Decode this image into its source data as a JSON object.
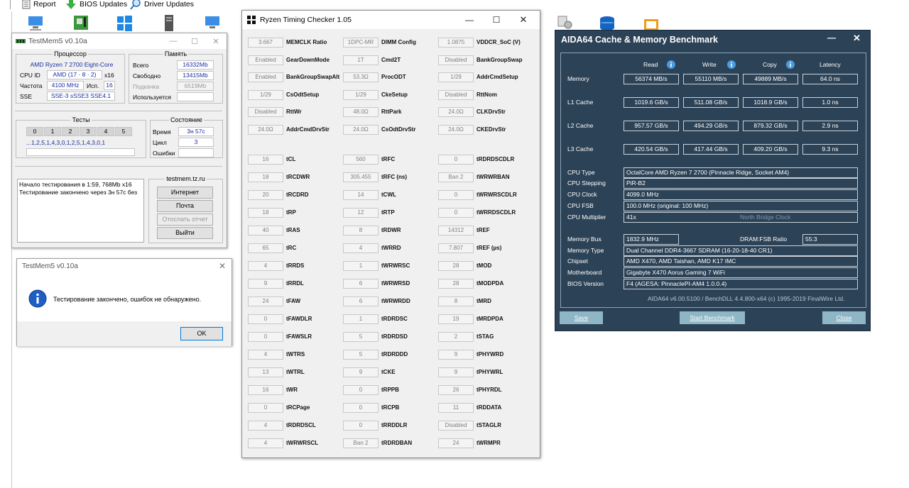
{
  "toolbar": {
    "report": "Report",
    "bios_updates": "BIOS Updates",
    "driver_updates": "Driver Updates"
  },
  "testmem_main": {
    "title": "TestMem5 v0.10a",
    "processor_legend": "Процессор",
    "cpu_name": "AMD Ryzen 7 2700 Eight-Core",
    "cpuid_label": "CPU ID",
    "cpuid_value": "AMD  (17 · 8 · 2)",
    "cpuid_threads": "x16",
    "freq_label": "Частота",
    "freq_value": "4100 MHz",
    "used_label": "Исп.",
    "used_value": "16",
    "sse_label": "SSE",
    "sse_value": "SSE-3 sSSE3 SSE4.1",
    "memory_legend": "Память",
    "total_label": "Всего",
    "total_value": "16332Mb",
    "free_label": "Свободно",
    "free_value": "13415Mb",
    "swap_label": "Подкачка",
    "swap_value": "6519Mb",
    "used2_label": "Используется",
    "used2_value": "",
    "tests_legend": "Тесты",
    "test_tabs": [
      "0",
      "1",
      "2",
      "3",
      "4",
      "5"
    ],
    "test_sequence": "...1,2,5,1,4,3,0,1,2,5,1,4,3,0,1",
    "state_legend": "Состояние",
    "time_label": "Время",
    "time_value": "3н 57с",
    "cycle_label": "Цикл",
    "cycle_value": "3",
    "errors_label": "Ошибки",
    "errors_value": "",
    "log_lines": [
      "Начало тестирования в 1:59, 768Mb x16",
      "Тестирование закончено через 3н 57с без"
    ],
    "site_legend": "testmem.tz.ru",
    "btn_internet": "Интернет",
    "btn_mail": "Почта",
    "btn_report": "Отослать отчет",
    "btn_exit": "Выйти"
  },
  "testmem_dialog": {
    "title": "TestMem5 v0.10a",
    "message": "Тестирование закончено, ошибок не обнаружено.",
    "ok": "OK"
  },
  "rtc": {
    "title": "Ryzen Timing Checker 1.05",
    "rows": [
      [
        [
          "3.667",
          "MEMCLK Ratio"
        ],
        [
          "1DPC-MR",
          "DIMM Config"
        ],
        [
          "1.0875",
          "VDDCR_SoC (V)"
        ]
      ],
      [
        [
          "Enabled",
          "GearDownMode"
        ],
        [
          "1T",
          "Cmd2T"
        ],
        [
          "Disabled",
          "BankGroupSwap"
        ]
      ],
      [
        [
          "Enabled",
          "BankGroupSwapAlt"
        ],
        [
          "53.3Ω",
          "ProcODT"
        ],
        [
          "1/29",
          "AddrCmdSetup"
        ]
      ],
      [
        [
          "1/29",
          "CsOdtSetup"
        ],
        [
          "1/29",
          "CkeSetup"
        ],
        [
          "Disabled",
          "RttNom"
        ]
      ],
      [
        [
          "Disabled",
          "RttWr"
        ],
        [
          "48.0Ω",
          "RttPark"
        ],
        [
          "24.0Ω",
          "CLKDrvStr"
        ]
      ],
      [
        [
          "24.0Ω",
          "AddrCmdDrvStr"
        ],
        [
          "24.0Ω",
          "CsOdtDrvStr"
        ],
        [
          "24.0Ω",
          "CKEDrvStr"
        ]
      ],
      [
        [
          "16",
          "tCL"
        ],
        [
          "560",
          "tRFC"
        ],
        [
          "0",
          "tRDRDSCDLR"
        ]
      ],
      [
        [
          "18",
          "tRCDWR"
        ],
        [
          "305.455",
          "tRFC (ns)"
        ],
        [
          "Ban 2",
          "tWRWRBAN"
        ]
      ],
      [
        [
          "20",
          "tRCDRD"
        ],
        [
          "14",
          "tCWL"
        ],
        [
          "0",
          "tWRWRSCDLR"
        ]
      ],
      [
        [
          "18",
          "tRP"
        ],
        [
          "12",
          "tRTP"
        ],
        [
          "0",
          "tWRRDSCDLR"
        ]
      ],
      [
        [
          "40",
          "tRAS"
        ],
        [
          "8",
          "tRDWR"
        ],
        [
          "14312",
          "tREF"
        ]
      ],
      [
        [
          "65",
          "tRC"
        ],
        [
          "4",
          "tWRRD"
        ],
        [
          "7.807",
          "tREF (µs)"
        ]
      ],
      [
        [
          "4",
          "tRRDS"
        ],
        [
          "1",
          "tWRWRSC"
        ],
        [
          "28",
          "tMOD"
        ]
      ],
      [
        [
          "9",
          "tRRDL"
        ],
        [
          "6",
          "tWRWRSD"
        ],
        [
          "28",
          "tMODPDA"
        ]
      ],
      [
        [
          "24",
          "tFAW"
        ],
        [
          "6",
          "tWRWRDD"
        ],
        [
          "8",
          "tMRD"
        ]
      ],
      [
        [
          "0",
          "tFAWDLR"
        ],
        [
          "1",
          "tRDRDSC"
        ],
        [
          "19",
          "tMRDPDA"
        ]
      ],
      [
        [
          "0",
          "tFAWSLR"
        ],
        [
          "5",
          "tRDRDSD"
        ],
        [
          "2",
          "tSTAG"
        ]
      ],
      [
        [
          "4",
          "tWTRS"
        ],
        [
          "5",
          "tRDRDDD"
        ],
        [
          "9",
          "tPHYWRD"
        ]
      ],
      [
        [
          "13",
          "tWTRL"
        ],
        [
          "9",
          "tCKE"
        ],
        [
          "9",
          "tPHYWRL"
        ]
      ],
      [
        [
          "16",
          "tWR"
        ],
        [
          "0",
          "tRPPB"
        ],
        [
          "26",
          "tPHYRDL"
        ]
      ],
      [
        [
          "0",
          "tRCPage"
        ],
        [
          "0",
          "tRCPB"
        ],
        [
          "11",
          "tRDDATA"
        ]
      ],
      [
        [
          "4",
          "tRDRDSCL"
        ],
        [
          "0",
          "tRRDDLR"
        ],
        [
          "Disabled",
          "tSTAGLR"
        ]
      ],
      [
        [
          "4",
          "tWRWRSCL"
        ],
        [
          "Ban 2",
          "tRDRDBAN"
        ],
        [
          "24",
          "tWRMPR"
        ]
      ]
    ]
  },
  "aida": {
    "title": "AIDA64 Cache & Memory Benchmark",
    "col_read": "Read",
    "col_write": "Write",
    "col_copy": "Copy",
    "col_latency": "Latency",
    "bench": [
      {
        "label": "Memory",
        "read": "56374 MB/s",
        "write": "55110 MB/s",
        "copy": "49889 MB/s",
        "latency": "64.0 ns"
      },
      {
        "label": "L1 Cache",
        "read": "1019.6 GB/s",
        "write": "511.08 GB/s",
        "copy": "1018.9 GB/s",
        "latency": "1.0 ns"
      },
      {
        "label": "L2 Cache",
        "read": "957.57 GB/s",
        "write": "494.29 GB/s",
        "copy": "879.32 GB/s",
        "latency": "2.9 ns"
      },
      {
        "label": "L3 Cache",
        "read": "420.54 GB/s",
        "write": "417.44 GB/s",
        "copy": "409.20 GB/s",
        "latency": "9.3 ns"
      }
    ],
    "cpu_type_label": "CPU Type",
    "cpu_type": "OctalCore AMD Ryzen 7 2700  (Pinnacle Ridge, Socket AM4)",
    "cpu_stepping_label": "CPU Stepping",
    "cpu_stepping": "PiR-B2",
    "cpu_clock_label": "CPU Clock",
    "cpu_clock": "4099.0 MHz",
    "cpu_fsb_label": "CPU FSB",
    "cpu_fsb": "100.0 MHz  (original: 100 MHz)",
    "cpu_mult_label": "CPU Multiplier",
    "cpu_mult": "41x",
    "nb_clock": "North Bridge Clock",
    "mem_bus_label": "Memory Bus",
    "mem_bus": "1832.9 MHz",
    "dram_fsb_label": "DRAM:FSB Ratio",
    "dram_fsb": "55:3",
    "mem_type_label": "Memory Type",
    "mem_type": "Dual Channel DDR4-3667 SDRAM  (16-20-18-40 CR1)",
    "chipset_label": "Chipset",
    "chipset": "AMD X470, AMD Taishan, AMD K17 IMC",
    "mobo_label": "Motherboard",
    "mobo": "Gigabyte X470 Aorus Gaming 7 WiFi",
    "bios_label": "BIOS Version",
    "bios": "F4  (AGESA: PinnaclePI-AM4 1.0.0.4)",
    "footer": "AIDA64 v6.00.5100 / BenchDLL 4.4.800-x64  (c) 1995-2019 FinalWire Ltd.",
    "btn_save": "Save",
    "btn_start": "Start Benchmark",
    "btn_close": "Close"
  }
}
